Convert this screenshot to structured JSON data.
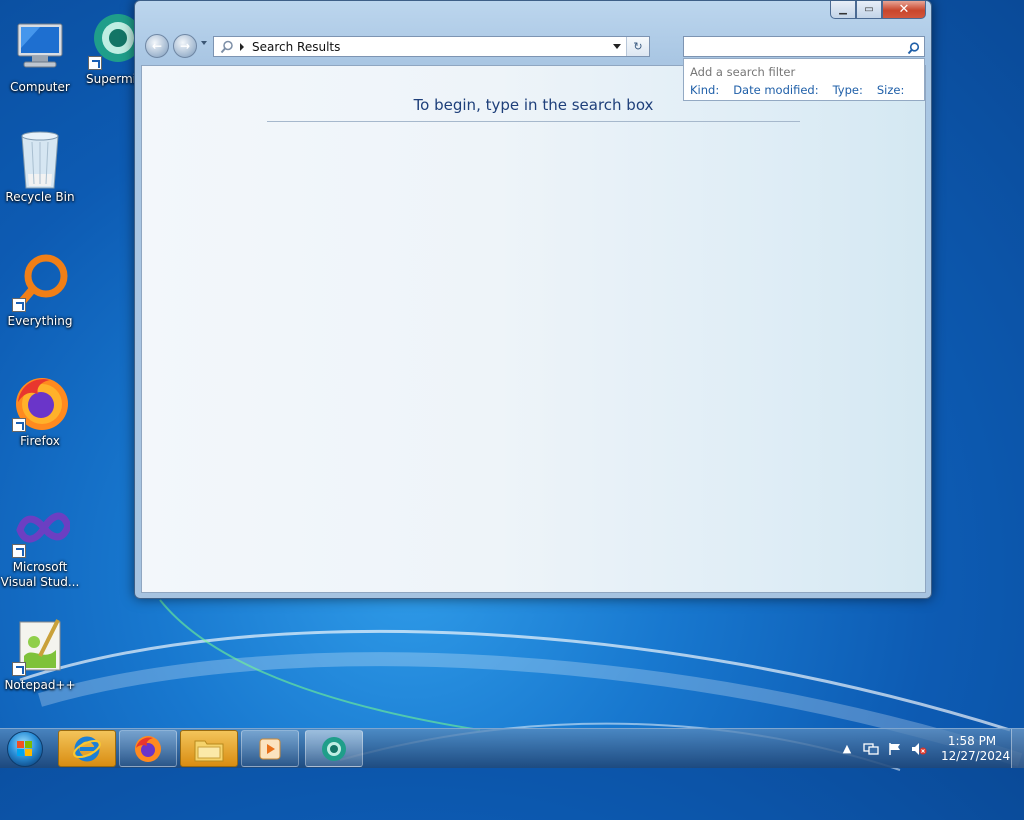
{
  "desktop": {
    "icons": [
      {
        "label": "Computer"
      },
      {
        "label": "Supermium"
      },
      {
        "label": "Recycle Bin"
      },
      {
        "label": "Everything"
      },
      {
        "label": "Firefox"
      },
      {
        "label": "Microsoft Visual Stud..."
      },
      {
        "label": "Notepad++"
      }
    ]
  },
  "window": {
    "caption": {
      "minimize": "▁",
      "maximize": "▭",
      "close": "✕"
    },
    "nav": {
      "back": "←",
      "forward": "→"
    },
    "address": {
      "current": "Search Results",
      "refresh": "↻"
    },
    "search": {
      "value": "",
      "placeholder": ""
    },
    "filter": {
      "hint": "Add a search filter",
      "options": [
        "Kind:",
        "Date modified:",
        "Type:",
        "Size:"
      ]
    },
    "content": {
      "message": "To begin, type in the search box"
    }
  },
  "taskbar": {
    "buttons": [
      "internet-explorer",
      "firefox",
      "file-explorer",
      "media-player",
      "supermium"
    ],
    "tray": {
      "chevron": "▲",
      "time": "1:58 PM",
      "date": "12/27/2024"
    }
  }
}
